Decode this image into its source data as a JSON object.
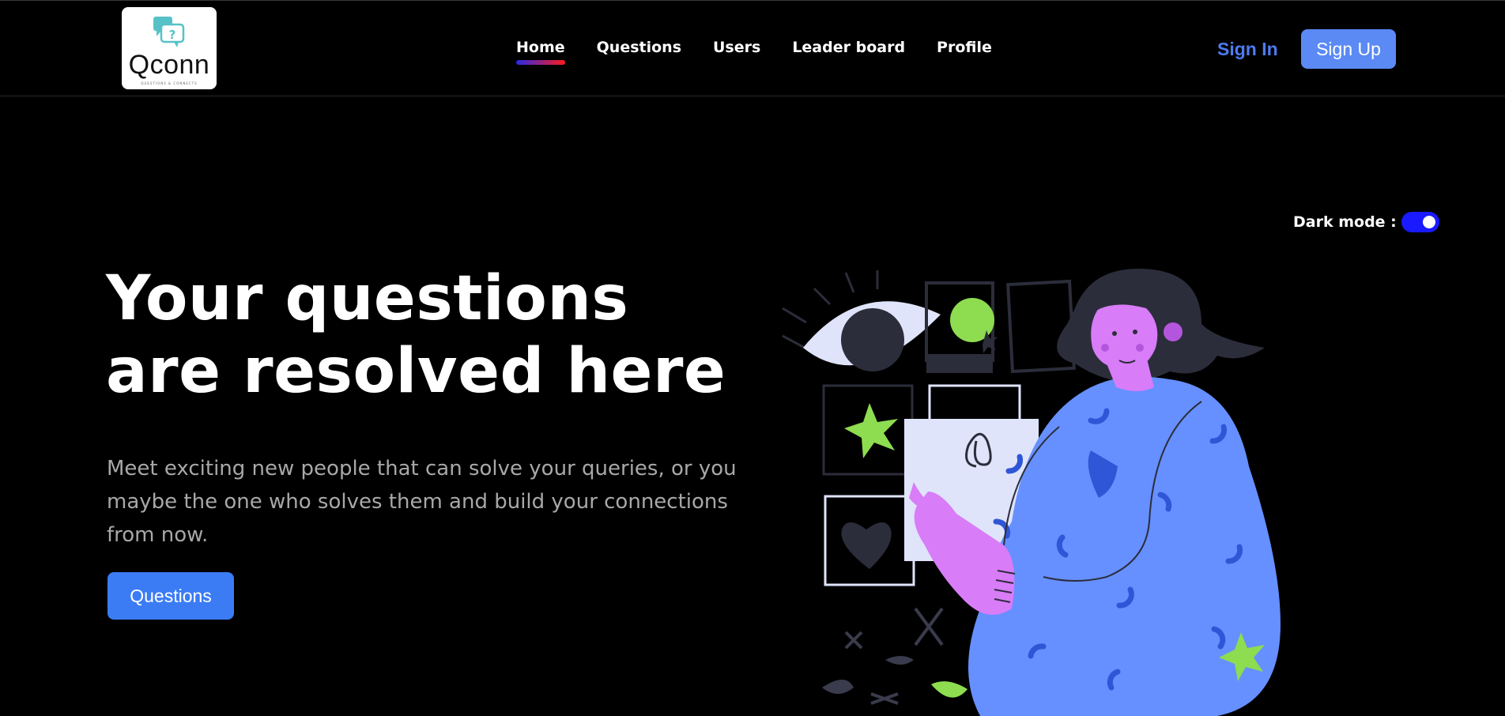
{
  "header": {
    "logo_text": "Qconn",
    "logo_tagline": "QUESTIONS & CONNECTS",
    "nav": [
      {
        "label": "Home",
        "active": true
      },
      {
        "label": "Questions",
        "active": false
      },
      {
        "label": "Users",
        "active": false
      },
      {
        "label": "Leader board",
        "active": false
      },
      {
        "label": "Profile",
        "active": false
      }
    ],
    "sign_in_label": "Sign In",
    "sign_up_label": "Sign Up"
  },
  "dark_mode": {
    "label": "Dark mode :",
    "on": true
  },
  "hero": {
    "title_line1": "Your questions",
    "title_line2": "are resolved here",
    "subtitle": "Meet exciting new people that can solve your queries, or you maybe the one who solves them and build your connections from now.",
    "button_label": "Questions"
  },
  "colors": {
    "accent_blue": "#5b8af5",
    "button_blue": "#3b7cf5",
    "toggle_blue": "#1a1aff",
    "nav_underline_start": "#2a2ae6",
    "nav_underline_end": "#ff1a1a",
    "illustration_green": "#8edc4f",
    "illustration_pink": "#d87cf8",
    "illustration_sweater": "#6690ff"
  },
  "icons": {
    "logo": "chat-question-icon",
    "illustration": "woman-pointing-illustration"
  }
}
